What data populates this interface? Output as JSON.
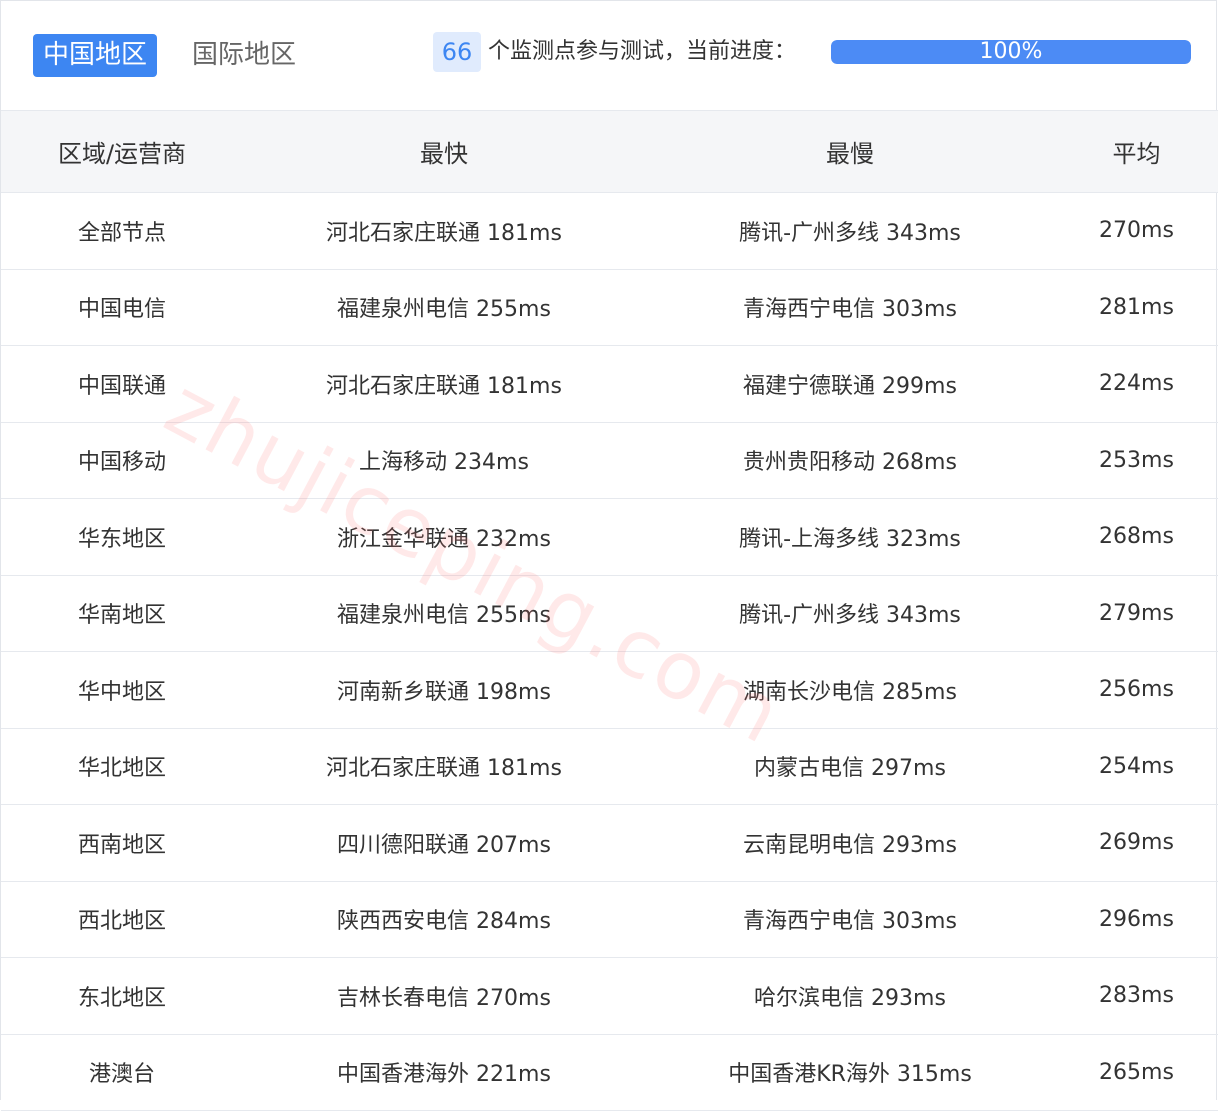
{
  "tabs": [
    {
      "label": "中国地区",
      "active": true
    },
    {
      "label": "国际地区",
      "active": false
    }
  ],
  "monitor": {
    "count": "66",
    "text": "个监测点参与测试，当前进度：",
    "progress_label": "100%",
    "progress_value": 1.0
  },
  "table": {
    "headers": [
      "区域/运营商",
      "最快",
      "最慢",
      "平均"
    ],
    "rows": [
      [
        "全部节点",
        "河北石家庄联通 181ms",
        "腾讯-广州多线 343ms",
        "270ms"
      ],
      [
        "中国电信",
        "福建泉州电信 255ms",
        "青海西宁电信 303ms",
        "281ms"
      ],
      [
        "中国联通",
        "河北石家庄联通 181ms",
        "福建宁德联通 299ms",
        "224ms"
      ],
      [
        "中国移动",
        "上海移动 234ms",
        "贵州贵阳移动 268ms",
        "253ms"
      ],
      [
        "华东地区",
        "浙江金华联通 232ms",
        "腾讯-上海多线 323ms",
        "268ms"
      ],
      [
        "华南地区",
        "福建泉州电信 255ms",
        "腾讯-广州多线 343ms",
        "279ms"
      ],
      [
        "华中地区",
        "河南新乡联通 198ms",
        "湖南长沙电信 285ms",
        "256ms"
      ],
      [
        "华北地区",
        "河北石家庄联通 181ms",
        "内蒙古电信 297ms",
        "254ms"
      ],
      [
        "西南地区",
        "四川德阳联通 207ms",
        "云南昆明电信 293ms",
        "269ms"
      ],
      [
        "西北地区",
        "陕西西安电信 284ms",
        "青海西宁电信 303ms",
        "296ms"
      ],
      [
        "东北地区",
        "吉林长春电信 270ms",
        "哈尔滨电信 293ms",
        "283ms"
      ],
      [
        "港澳台",
        "中国香港海外 221ms",
        "中国香港KR海外 315ms",
        "265ms"
      ]
    ]
  },
  "watermark": "zhujiceping.com",
  "colors": {
    "accent": "#3d86f2",
    "progress": "#4c8bf5",
    "badge_bg": "#e0ebfd",
    "header_bg": "#f5f6f8"
  }
}
